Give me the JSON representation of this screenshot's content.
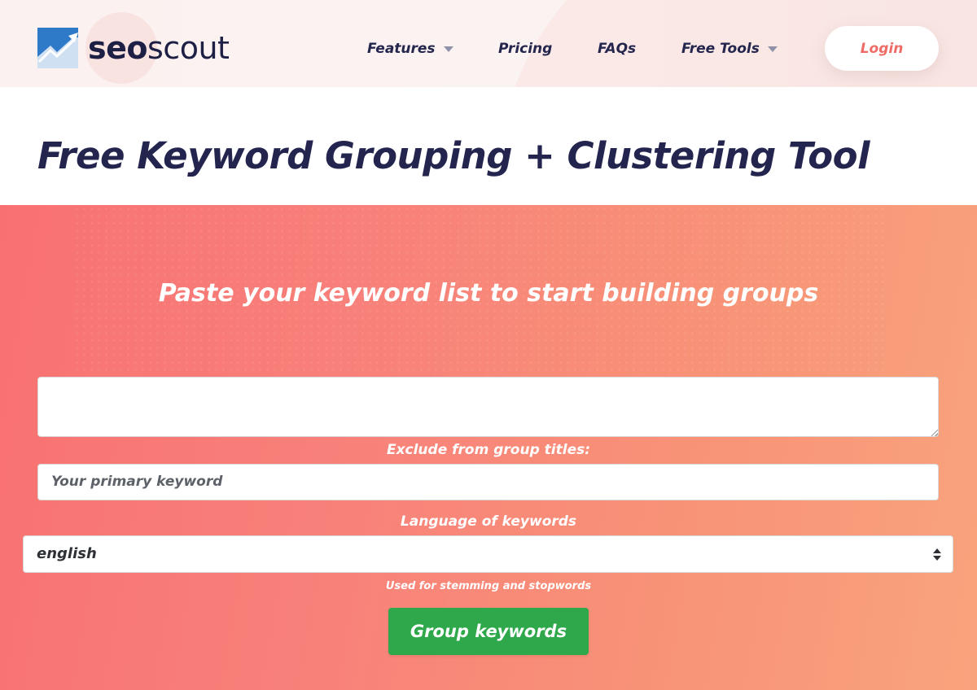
{
  "brand": {
    "name_bold": "seo",
    "name_light": "scout",
    "colors": {
      "navy": "#1d1f44",
      "accent": "#ee6b66",
      "cta": "#2ea84a",
      "logo_blue": "#2f79c9"
    }
  },
  "nav": {
    "items": [
      {
        "label": "Features",
        "has_dropdown": true,
        "icon": "chevron-down-icon"
      },
      {
        "label": "Pricing",
        "has_dropdown": false
      },
      {
        "label": "FAQs",
        "has_dropdown": false
      },
      {
        "label": "Free Tools",
        "has_dropdown": true,
        "icon": "chevron-down-icon"
      }
    ],
    "login_label": "Login"
  },
  "page": {
    "title": "Free Keyword Grouping + Clustering Tool"
  },
  "hero": {
    "heading": "Paste your keyword list to start building groups",
    "keywords_textarea": {
      "value": ""
    },
    "exclude_label": "Exclude from group titles:",
    "exclude_input": {
      "placeholder": "Your primary keyword",
      "value": ""
    },
    "language_label": "Language of keywords",
    "language_select": {
      "selected": "english"
    },
    "language_help": "Used for stemming and stopwords",
    "submit_label": "Group keywords"
  }
}
